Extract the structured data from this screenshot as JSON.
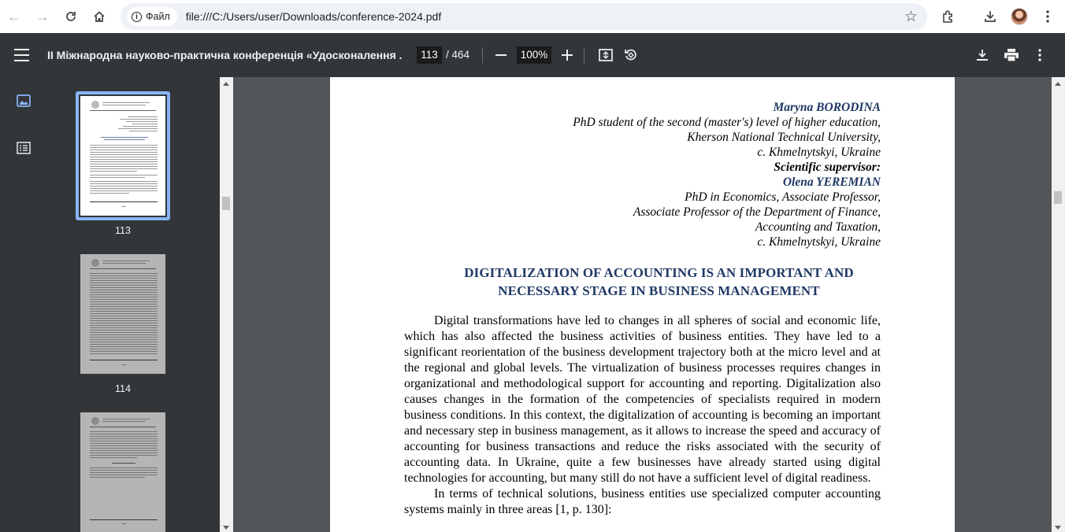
{
  "browser": {
    "site_chip_label": "Файл",
    "url": "file:///C:/Users/user/Downloads/conference-2024.pdf"
  },
  "toolbar": {
    "title": "II Міжнародна науково-практична конференція «Удосконалення ...",
    "current_page": "113",
    "total_pages": "/ 464",
    "zoom": "100%"
  },
  "sidebar": {
    "thumbnails": [
      {
        "label": "113",
        "selected": true
      },
      {
        "label": "114",
        "selected": false
      },
      {
        "label": "",
        "selected": false
      }
    ]
  },
  "document": {
    "author_lines": [
      "Maryna BORODINA",
      "PhD student of the second (master's) level of higher education,",
      "Kherson National Technical University,",
      "c. Khmelnytskyi, Ukraine",
      "Scientific supervisor:",
      "Olena YEREMIAN",
      "PhD in Economics, Associate Professor,",
      "Associate Professor of the Department of Finance,",
      "Accounting and Taxation,",
      "c. Khmelnytskyi, Ukraine"
    ],
    "heading_line1": "DIGITALIZATION OF ACCOUNTING IS AN IMPORTANT AND",
    "heading_line2": "NECESSARY STAGE IN BUSINESS MANAGEMENT",
    "paragraph1": "Digital transformations have led to changes in all spheres of social and economic life, which has also affected the business activities of business entities. They have led to a significant reorientation of the business development trajectory both at the micro level and at the regional and global levels. The virtualization of business processes requires changes in organizational and methodological support for accounting and reporting. Digitalization also causes changes in the formation of the competencies of specialists required in modern business conditions. In this context, the digitalization of accounting is becoming an important and necessary step in business management, as it allows to increase the speed and accuracy of accounting for business transactions and reduce the risks associated with the security of accounting data. In Ukraine, quite a few businesses have already started using digital technologies for accounting, but many still do not have a sufficient level of digital readiness.",
    "paragraph2": "In terms of technical solutions, business entities use specialized computer accounting systems mainly in three areas [1, p. 130]:"
  }
}
